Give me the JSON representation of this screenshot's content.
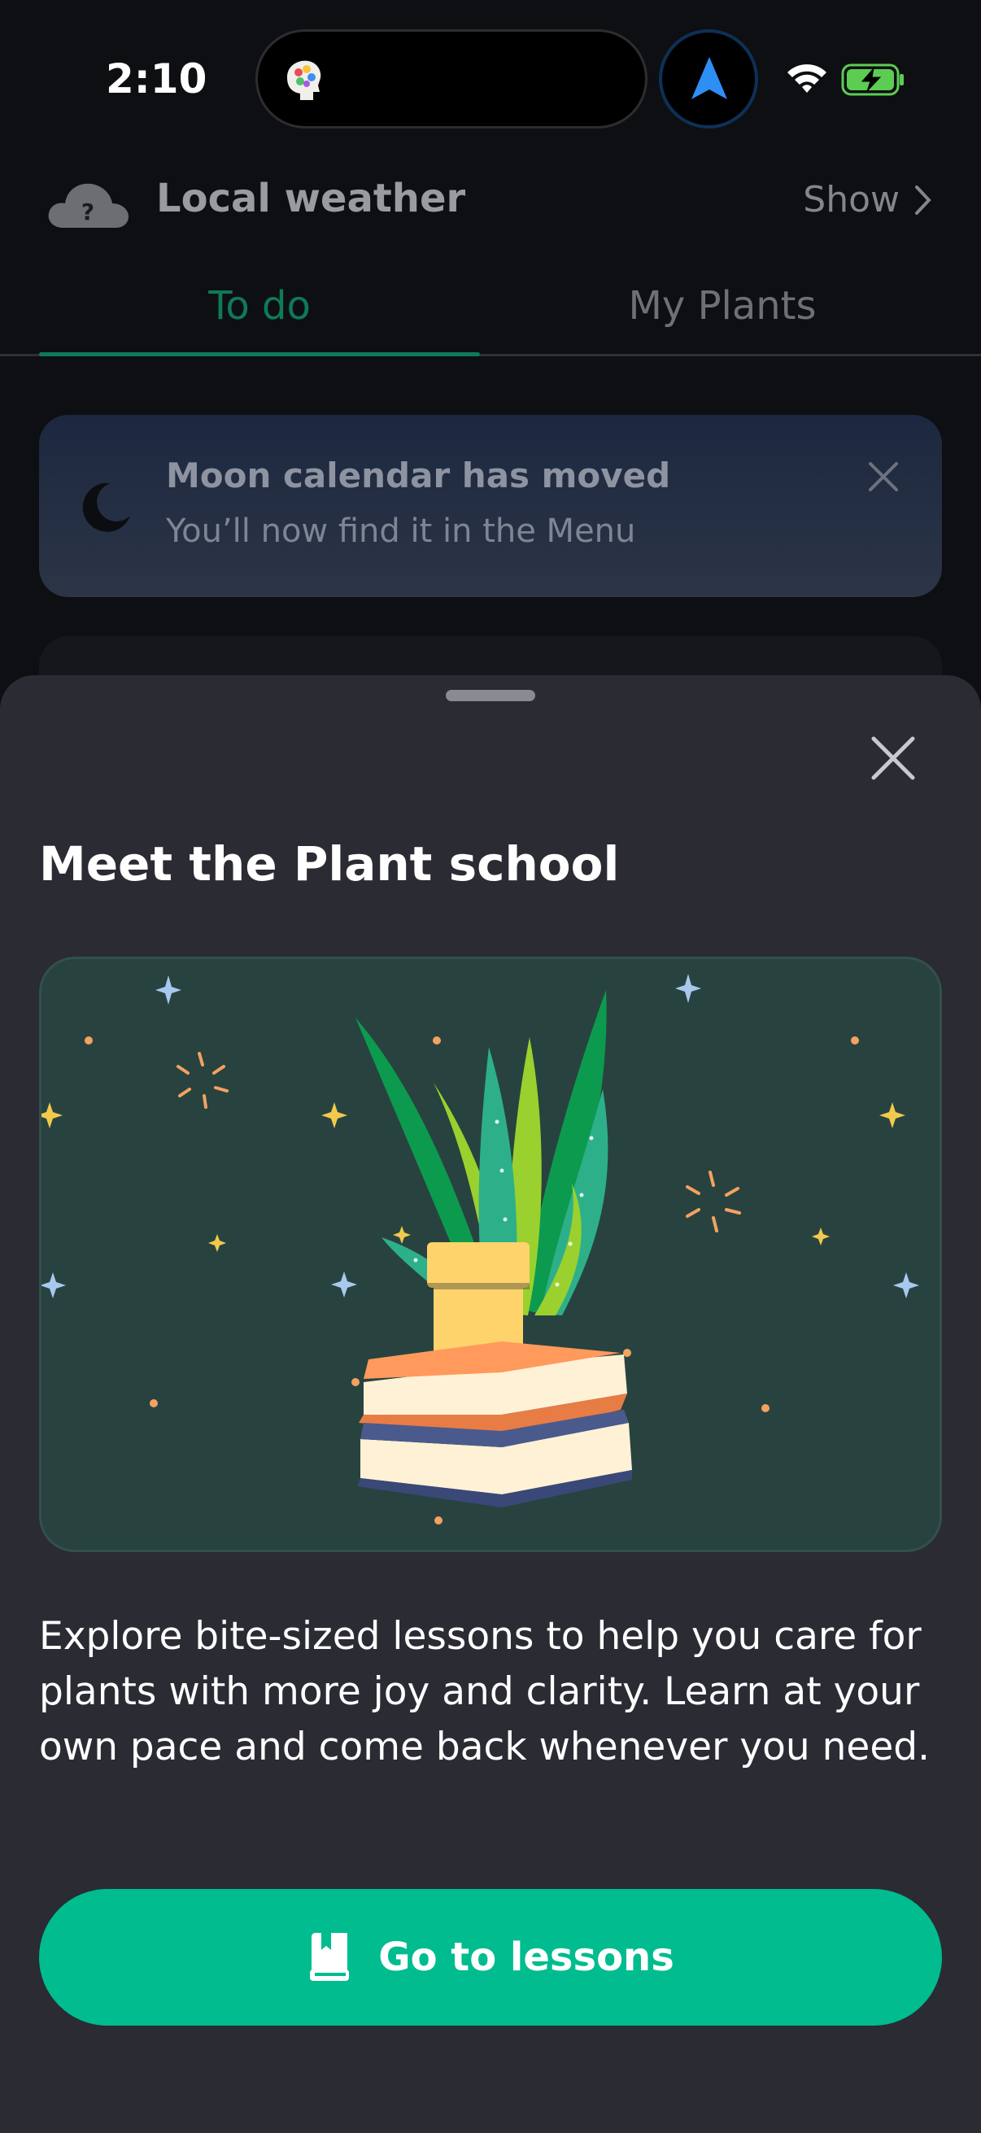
{
  "status_bar": {
    "time": "2:10",
    "icons": [
      "app-icon",
      "navigation-arrow-icon",
      "wifi-icon",
      "battery-charging-icon"
    ]
  },
  "weather": {
    "label": "Local weather",
    "show_label": "Show"
  },
  "tabs": [
    {
      "label": "To do",
      "active": true
    },
    {
      "label": "My Plants",
      "active": false
    }
  ],
  "moon_banner": {
    "title": "Moon calendar has moved",
    "subtitle": "You’ll now find it in the Menu"
  },
  "sheet": {
    "title": "Meet the Plant school",
    "description": "Explore bite-sized lessons to help you care for plants with more joy and clarity. Learn at your own pace and come back whenever you need.",
    "cta_label": "Go to lessons",
    "cta_icon": "book-icon"
  },
  "colors": {
    "accent": "#00bc8f",
    "tab_active": "#0e7a59",
    "sheet_background": "#2a2b33",
    "illustration_background": "#28433f"
  }
}
